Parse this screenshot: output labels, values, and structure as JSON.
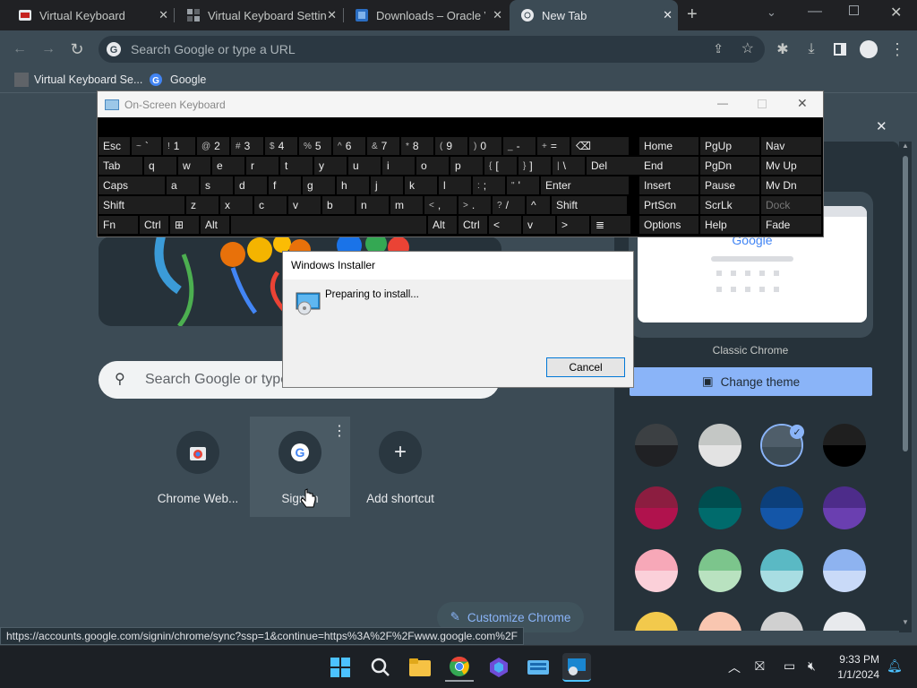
{
  "browser": {
    "tabs": [
      {
        "title": "Virtual Keyboard",
        "active": false
      },
      {
        "title": "Virtual Keyboard Settin",
        "active": false
      },
      {
        "title": "Downloads – Oracle V",
        "active": false
      },
      {
        "title": "New Tab",
        "active": true
      }
    ],
    "omnibox_placeholder": "Search Google or type a URL",
    "bookmarks": [
      {
        "label": "Virtual Keyboard Se..."
      },
      {
        "label": "Google"
      }
    ]
  },
  "ntp": {
    "search_placeholder": "Search Google or type",
    "shortcuts": [
      {
        "label": "Chrome Web..."
      },
      {
        "label": "Sign in"
      },
      {
        "label": "Add shortcut"
      }
    ],
    "customize_label": "Customize Chrome"
  },
  "side_panel": {
    "preview_logo": "Google",
    "theme_name": "Classic Chrome",
    "change_theme_label": "Change theme",
    "swatch_colors": [
      [
        "#3c4043",
        "#202124"
      ],
      [
        "#c4c7c5",
        "#e3e3e3"
      ],
      [
        "#4f5e6a",
        "#3c4b55"
      ],
      [
        "#1f1f1f",
        "#000000"
      ],
      [
        "#8c1d40",
        "#b0124d"
      ],
      [
        "#004d4f",
        "#006b6c"
      ],
      [
        "#0c3f7a",
        "#1456a8"
      ],
      [
        "#4d2c8a",
        "#6a3fb0"
      ],
      [
        "#f7a8b8",
        "#fbd0d9"
      ],
      [
        "#7cc58c",
        "#b9e2c0"
      ],
      [
        "#5ab9c4",
        "#a8dde2"
      ],
      [
        "#8eb3f0",
        "#c9daf8"
      ],
      [
        "#f2c94c",
        "#f2c94c"
      ],
      [
        "#f9c6b0",
        "#f9c6b0"
      ],
      [
        "#d0d0d0",
        "#d0d0d0"
      ],
      [
        "#e8eaed",
        "#ffffff"
      ]
    ]
  },
  "osk": {
    "title": "On-Screen Keyboard",
    "rows": [
      [
        {
          "k": "Esc"
        },
        {
          "s": "~",
          "k": "`"
        },
        {
          "s": "!",
          "k": "1"
        },
        {
          "s": "@",
          "k": "2"
        },
        {
          "s": "#",
          "k": "3"
        },
        {
          "s": "$",
          "k": "4"
        },
        {
          "s": "%",
          "k": "5"
        },
        {
          "s": "^",
          "k": "6"
        },
        {
          "s": "&",
          "k": "7"
        },
        {
          "s": "*",
          "k": "8"
        },
        {
          "s": "(",
          "k": "9"
        },
        {
          "s": ")",
          "k": "0"
        },
        {
          "s": "_",
          "k": "-"
        },
        {
          "s": "+",
          "k": "="
        },
        {
          "k": "⌫"
        }
      ],
      [
        {
          "k": "Tab"
        },
        {
          "k": "q"
        },
        {
          "k": "w"
        },
        {
          "k": "e"
        },
        {
          "k": "r"
        },
        {
          "k": "t"
        },
        {
          "k": "y"
        },
        {
          "k": "u"
        },
        {
          "k": "i"
        },
        {
          "k": "o"
        },
        {
          "k": "p"
        },
        {
          "s": "{",
          "k": "["
        },
        {
          "s": "}",
          "k": "]"
        },
        {
          "s": "|",
          "k": "\\"
        },
        {
          "k": "Del"
        }
      ],
      [
        {
          "k": "Caps"
        },
        {
          "k": "a"
        },
        {
          "k": "s"
        },
        {
          "k": "d"
        },
        {
          "k": "f"
        },
        {
          "k": "g"
        },
        {
          "k": "h"
        },
        {
          "k": "j"
        },
        {
          "k": "k"
        },
        {
          "k": "l"
        },
        {
          "s": ":",
          "k": ";"
        },
        {
          "s": "\"",
          "k": "'"
        },
        {
          "k": "Enter"
        }
      ],
      [
        {
          "k": "Shift"
        },
        {
          "k": "z"
        },
        {
          "k": "x"
        },
        {
          "k": "c"
        },
        {
          "k": "v"
        },
        {
          "k": "b"
        },
        {
          "k": "n"
        },
        {
          "k": "m"
        },
        {
          "s": "<",
          "k": ","
        },
        {
          "s": ">",
          "k": "."
        },
        {
          "s": "?",
          "k": "/"
        },
        {
          "k": "^"
        },
        {
          "k": "Shift"
        }
      ],
      [
        {
          "k": "Fn"
        },
        {
          "k": "Ctrl"
        },
        {
          "k": "⊞"
        },
        {
          "k": "Alt"
        },
        {
          "k": ""
        },
        {
          "k": "Alt"
        },
        {
          "k": "Ctrl"
        },
        {
          "k": "<"
        },
        {
          "k": "v"
        },
        {
          "k": ">"
        },
        {
          "k": "≣"
        }
      ]
    ],
    "nav": [
      [
        "Home",
        "PgUp",
        "Nav"
      ],
      [
        "End",
        "PgDn",
        "Mv Up"
      ],
      [
        "Insert",
        "Pause",
        "Mv Dn"
      ],
      [
        "PrtScn",
        "ScrLk",
        "Dock"
      ],
      [
        "Options",
        "Help",
        "Fade"
      ]
    ]
  },
  "installer": {
    "title": "Windows Installer",
    "message": "Preparing to install...",
    "cancel_label": "Cancel"
  },
  "status_url": "https://accounts.google.com/signin/chrome/sync?ssp=1&continue=https%3A%2F%2Fwww.google.com%2F",
  "taskbar": {
    "time": "9:33 PM",
    "date": "1/1/2024"
  }
}
